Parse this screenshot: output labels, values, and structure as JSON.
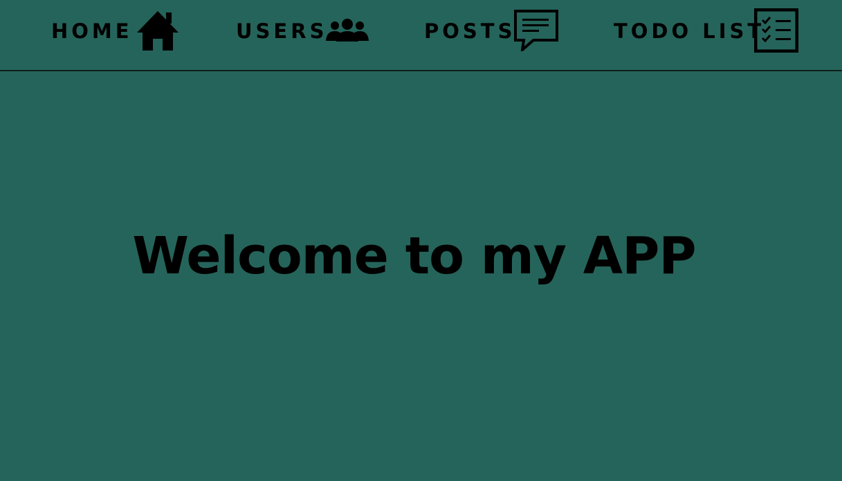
{
  "nav": {
    "items": [
      {
        "label": "HOME",
        "icon": "home-icon"
      },
      {
        "label": "USERS",
        "icon": "users-icon"
      },
      {
        "label": "POSTS",
        "icon": "chat-bubble-icon"
      },
      {
        "label": "TODO LIST",
        "icon": "checklist-icon"
      }
    ]
  },
  "hero": {
    "title": "Welcome to my APP"
  },
  "colors": {
    "background": "#25645A",
    "text": "#000000",
    "divider": "#0c1f1b"
  }
}
